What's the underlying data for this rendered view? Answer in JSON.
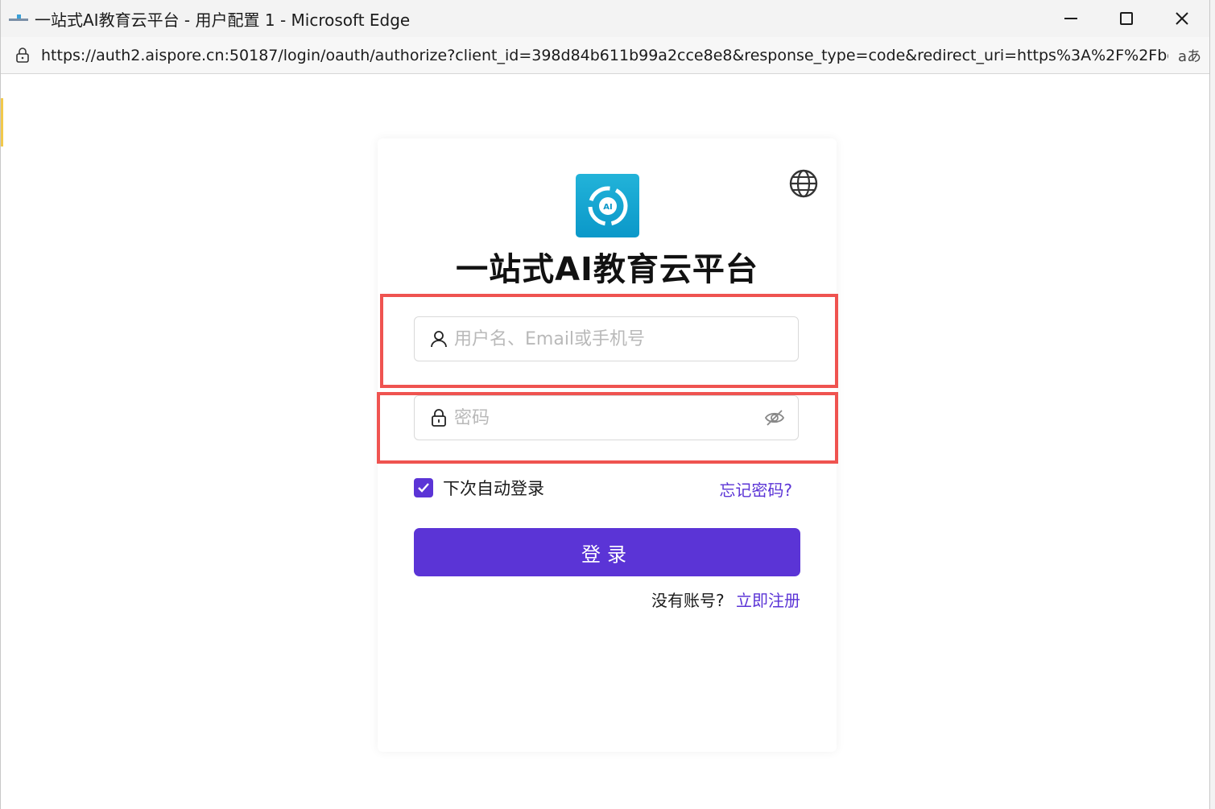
{
  "window": {
    "title": "一站式AI教育云平台 - 用户配置 1 - Microsoft Edge"
  },
  "addressbar": {
    "url": "https://auth2.aispore.cn:50187/login/oauth/authorize?client_id=398d84b611b99a2cce8e8&response_type=code&redirect_uri=https%3A%2F%2Fbot.ai...",
    "read_aloud": "aあ"
  },
  "login": {
    "brand_title": "一站式AI教育云平台",
    "username_placeholder": "用户名、Email或手机号",
    "password_placeholder": "密码",
    "remember_label": "下次自动登录",
    "remember_checked": true,
    "forgot_label": "忘记密码?",
    "submit_label": "登录",
    "no_account_text": "没有账号?",
    "register_label": "立即注册"
  },
  "colors": {
    "primary": "#5b34d6",
    "highlight_border": "#ef5350",
    "logo_bg": "#0ea5d3"
  },
  "icons": {
    "language": "globe-icon",
    "username": "user-icon",
    "password": "lock-icon",
    "visibility": "eye-off-icon",
    "site": "padlock-icon"
  }
}
